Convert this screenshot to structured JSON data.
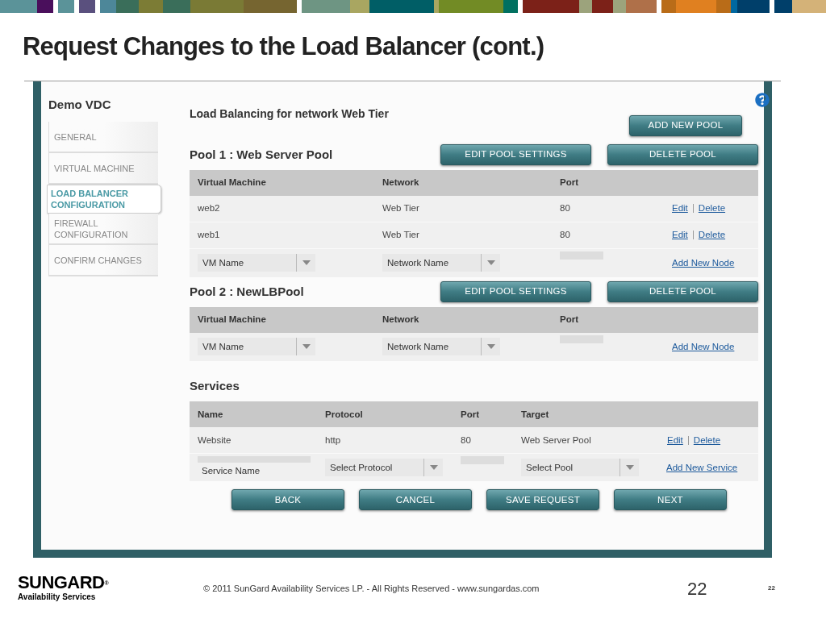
{
  "slide": {
    "title": "Request Changes to the Load Balancer (cont.)",
    "logo_name": "SUNGARD",
    "logo_mark": "®",
    "logo_tagline": "Availability Services",
    "copyright": "© 2011 SunGard Availability Services LP. - All Rights Reserved - www.sungardas.com",
    "page_number": "22",
    "page_number_small": "22"
  },
  "sidebar": {
    "title": "Demo VDC",
    "items": [
      {
        "label": "GENERAL",
        "selected": false
      },
      {
        "label": "VIRTUAL MACHINE",
        "selected": false
      },
      {
        "label": "LOAD BALANCER CONFIGURATION",
        "selected": true
      },
      {
        "label": "FIREWALL CONFIGURATION",
        "selected": false
      },
      {
        "label": "CONFIRM CHANGES",
        "selected": false
      }
    ]
  },
  "content": {
    "heading": "Load Balancing for network Web Tier",
    "add_pool_button": "ADD NEW POOL"
  },
  "pools": [
    {
      "title": "Pool 1 : Web Server Pool",
      "buttons": [
        "EDIT POOL SETTINGS",
        "DELETE POOL"
      ],
      "columns": [
        "Virtual Machine",
        "Network",
        "Port"
      ],
      "rows": [
        {
          "cells": [
            "web2",
            "Web Tier",
            "80"
          ],
          "actions": [
            "Edit",
            "Delete"
          ]
        },
        {
          "cells": [
            "web1",
            "Web Tier",
            "80"
          ],
          "actions": [
            "Edit",
            "Delete"
          ]
        }
      ],
      "new_row": {
        "vm_placeholder": "VM Name",
        "network_placeholder": "Network Name",
        "action": "Add New Node"
      }
    },
    {
      "title": "Pool 2 : NewLBPool",
      "buttons": [
        "EDIT POOL SETTINGS",
        "DELETE POOL"
      ],
      "columns": [
        "Virtual Machine",
        "Network",
        "Port"
      ],
      "new_row": {
        "vm_placeholder": "VM Name",
        "network_placeholder": "Network Name",
        "action": "Add New Node"
      }
    }
  ],
  "services": {
    "title": "Services",
    "columns": [
      "Name",
      "Protocol",
      "Port",
      "Target"
    ],
    "rows": [
      {
        "cells": [
          "Website",
          "http",
          "80",
          "Web Server Pool"
        ],
        "actions": [
          "Edit",
          "Delete"
        ]
      }
    ],
    "new_row": {
      "name_placeholder": "Service Name",
      "protocol_placeholder": "Select Protocol",
      "pool_placeholder": "Select Pool",
      "action": "Add New Service"
    }
  },
  "footer_buttons": [
    "BACK",
    "CANCEL",
    "SAVE REQUEST",
    "NEXT"
  ]
}
